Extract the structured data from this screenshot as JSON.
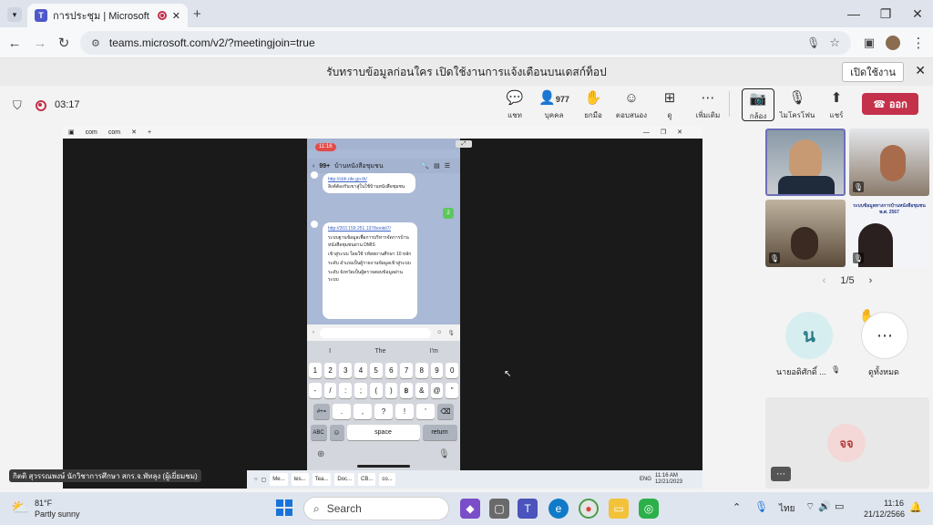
{
  "browser": {
    "tab_title": "การประชุม | Microsoft Teams",
    "url": "teams.microsoft.com/v2/?meetingjoin=true"
  },
  "notification": {
    "text": "รับทราบข้อมูลก่อนใคร เปิดใช้งานการแจ้งเตือนบนเดสก์ท็อป",
    "enable_label": "เปิดใช้งาน"
  },
  "meeting": {
    "timer": "03:17",
    "toolbar": [
      {
        "id": "chat",
        "label": "แชท",
        "icon": "chat-icon"
      },
      {
        "id": "people",
        "label": "บุคคล",
        "icon": "people-icon",
        "count": "977"
      },
      {
        "id": "raise",
        "label": "ยกมือ",
        "icon": "hand-icon"
      },
      {
        "id": "react",
        "label": "ตอบสนอง",
        "icon": "smile-icon"
      },
      {
        "id": "view",
        "label": "ดู",
        "icon": "grid-icon"
      },
      {
        "id": "more",
        "label": "เพิ่มเติม",
        "icon": "more-icon"
      },
      {
        "id": "camera",
        "label": "กล้อง",
        "icon": "camera-off-icon"
      },
      {
        "id": "mic",
        "label": "ไมโครโฟน",
        "icon": "mic-off-icon"
      },
      {
        "id": "share",
        "label": "แชร์",
        "icon": "share-icon"
      }
    ],
    "leave_label": "ออก"
  },
  "shared_screen": {
    "tabs": [
      "com",
      "com"
    ],
    "phone": {
      "status_time": "11:16",
      "chat_count": "99+",
      "chat_title": "บ้านหนังสือชุมชน",
      "bubble1_link": "http://cbh.nfe.go.th/",
      "bubble1_text": "ลิงค์ต้องรับเขาสู่ในใช้บ้านหนังสือชุมชน",
      "badge": "2",
      "bubble2_link": "http://203.159.251.137/bookit7/",
      "bubble2_lines": [
        "ระบบฐานข้อมูลเพื่อการบริหารจัดการบ้านหนังสือชุมชนผ่าน DMIS",
        "เข้าสู่ระบบ ใดยใช้ รหัสสถานศึกษา 10 หลัก",
        "ระดับ อำเภอเป็นผู้รายงานข้อมูลเข้าสู่ระบบ",
        "ระดับ จังหวัดเป็นผู้ตรวจสอบข้อมูลผ่านระบบ"
      ],
      "suggestions": [
        "I",
        "The",
        "I'm"
      ],
      "keyboard_rows": [
        [
          "1",
          "2",
          "3",
          "4",
          "5",
          "6",
          "7",
          "8",
          "9",
          "0"
        ],
        [
          "-",
          "/",
          ":",
          ";",
          "(",
          ")",
          "฿",
          "&",
          "@",
          "\""
        ],
        [
          "#+=",
          ".",
          ",",
          "?",
          "!",
          "'",
          "⌫"
        ],
        [
          "ABC",
          "☺",
          "space",
          "return"
        ]
      ]
    },
    "inner_taskbar": {
      "items": [
        "Me...",
        "tes...",
        "Tea...",
        "Doc...",
        "CB...",
        "co..."
      ],
      "lang": "ENG",
      "time": "11:16 AM",
      "date": "12/21/2023"
    },
    "presenter_label": "กิตติ สุวรรณพงษ์ นักวิชาการศึกษา สกร.จ.พัทลุง (ผู้เยี่ยมชม)"
  },
  "participants": {
    "page": "1/5",
    "tile3_text": "ระบบข้อมูลทางการบ้านหนังสือชุมชน พ.ศ. 2567",
    "avatar1_initial": "น",
    "avatar1_name": "นายอดิศักดิ์ ...",
    "view_all_label": "ดูทั้งหมด",
    "avatar2_initials": "จจ",
    "colors": {
      "avatar1_bg": "#d7eef0",
      "avatar1_fg": "#2a7c86",
      "avatar2_bg": "#f4d7d7",
      "avatar2_fg": "#b33b3b"
    }
  },
  "taskbar": {
    "weather_temp": "81°F",
    "weather_desc": "Partly sunny",
    "search_placeholder": "Search",
    "lang": "ไทย",
    "time": "11:16",
    "date": "21/12/2566"
  }
}
